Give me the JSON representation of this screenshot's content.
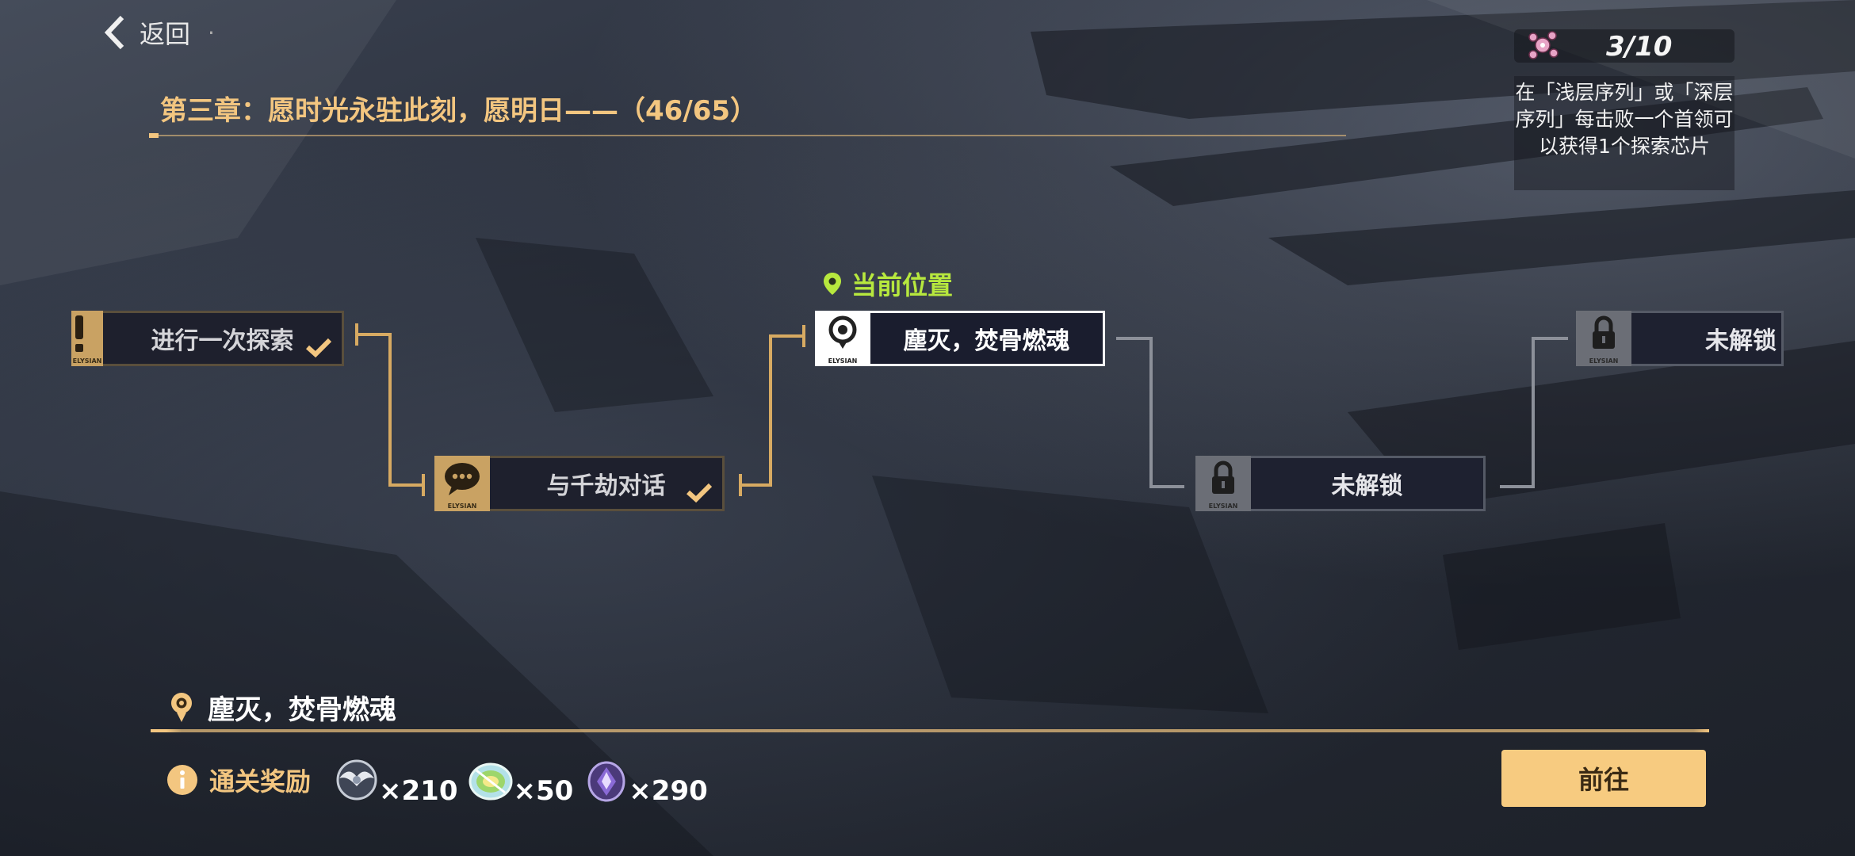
{
  "header": {
    "back_label": "返回",
    "chapter_title": "第三章：愿时光永驻此刻，愿明日——（46/65）"
  },
  "chip_counter": {
    "count": "3/10",
    "description": "在「浅层序列」或「深层序列」每击败一个首领可以获得1个探索芯片"
  },
  "map": {
    "current_position_label": "当前位置",
    "nodes": [
      {
        "label": "进行一次探索",
        "state": "completed",
        "icon": "exclamation-icon"
      },
      {
        "label": "与千劫对话",
        "state": "completed",
        "icon": "chat-bubble-icon"
      },
      {
        "label": "塵灭，焚骨燃魂",
        "state": "current",
        "icon": "location-pin-icon"
      },
      {
        "label": "未解锁",
        "state": "locked",
        "icon": "lock-icon"
      },
      {
        "label": "未解锁",
        "state": "locked",
        "icon": "lock-icon"
      }
    ],
    "badge_text": "ELYSIAN"
  },
  "selected_stage": {
    "label": "塵灭，焚骨燃魂"
  },
  "rewards": {
    "title": "通关奖励",
    "items": [
      {
        "icon": "wings-emblem-icon",
        "quantity": "×210"
      },
      {
        "icon": "rainbow-disc-icon",
        "quantity": "×50"
      },
      {
        "icon": "purple-crystal-icon",
        "quantity": "×290"
      }
    ]
  },
  "go_button": {
    "label": "前往"
  },
  "colors": {
    "accent_gold": "#f3c680",
    "current_green": "#b7e83e",
    "button_bg": "#f7cb80"
  }
}
